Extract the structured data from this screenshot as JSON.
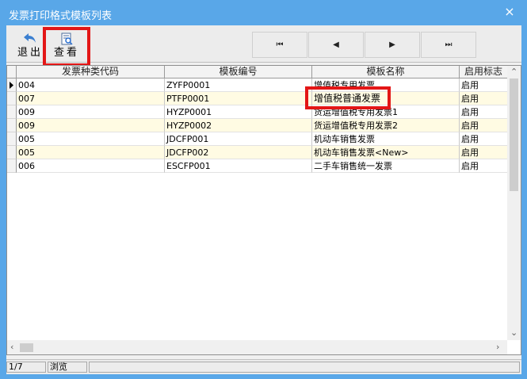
{
  "window": {
    "title": "发票打印格式模板列表",
    "close_label": "×"
  },
  "toolbar": {
    "exit_label": "退出",
    "view_label": "查看",
    "first_label": "⏮",
    "prev_label": "◀",
    "next_label": "▶",
    "last_label": "⏭"
  },
  "table": {
    "columns": [
      "发票种类代码",
      "模板编号",
      "模板名称",
      "启用标志"
    ],
    "rows": [
      {
        "code": "004",
        "template_no": "ZYFP0001",
        "template_name": "增值税专用发票",
        "status": "启用"
      },
      {
        "code": "007",
        "template_no": "PTFP0001",
        "template_name": "增值税普通发票",
        "status": "启用"
      },
      {
        "code": "009",
        "template_no": "HYZP0001",
        "template_name": "货运增值税专用发票1",
        "status": "启用"
      },
      {
        "code": "009",
        "template_no": "HYZP0002",
        "template_name": "货运增值税专用发票2",
        "status": "启用"
      },
      {
        "code": "005",
        "template_no": "JDCFP001",
        "template_name": "机动车销售发票",
        "status": "启用"
      },
      {
        "code": "005",
        "template_no": "JDCFP002",
        "template_name": "机动车销售发票<New>",
        "status": "启用"
      },
      {
        "code": "006",
        "template_no": "ESCFP001",
        "template_name": "二手车销售统一发票",
        "status": "启用"
      }
    ]
  },
  "status": {
    "record": "1/7",
    "mode": "浏览"
  },
  "colors": {
    "title_bar": "#59a7e8",
    "alt_row": "#fffbe3",
    "highlight": "#e31616"
  }
}
